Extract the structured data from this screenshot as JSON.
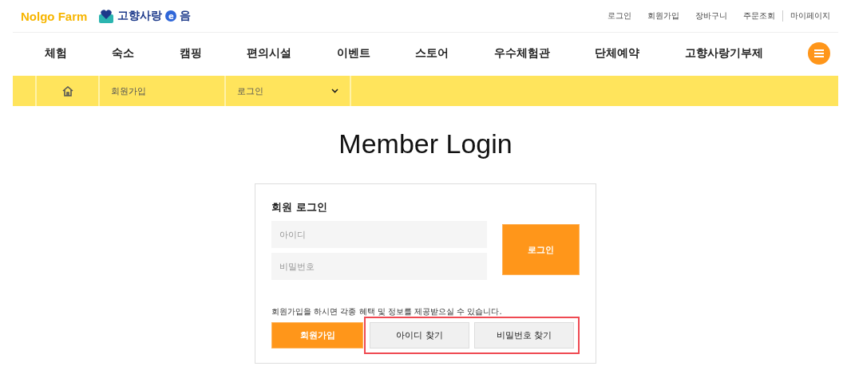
{
  "logos": {
    "brand": "Nolgo Farm",
    "partner": {
      "text": "고향사랑",
      "badge": "e",
      "suffix": "음"
    }
  },
  "top_links": [
    {
      "label": "로그인",
      "divider_before": false
    },
    {
      "label": "회원가입",
      "divider_before": false
    },
    {
      "label": "장바구니",
      "divider_before": false
    },
    {
      "label": "주문조회",
      "divider_before": false
    },
    {
      "label": "마이페이지",
      "divider_before": true
    }
  ],
  "nav": [
    "체험",
    "숙소",
    "캠핑",
    "편의시설",
    "이벤트",
    "스토어",
    "우수체험관",
    "단체예약",
    "고향사랑기부제"
  ],
  "breadcrumb": {
    "section": "회원가입",
    "current": "로그인"
  },
  "title": "Member Login",
  "login": {
    "heading": "회원 로그인",
    "id_placeholder": "아이디",
    "password_placeholder": "비밀번호",
    "submit": "로그인",
    "note": "회원가입을 하시면 각종 혜택 및 정보를 제공받으실 수 있습니다.",
    "signup": "회원가입",
    "find_buttons": {
      "highlighted": true,
      "items": [
        "아이디 찾기",
        "비밀번호 찾기"
      ]
    }
  }
}
